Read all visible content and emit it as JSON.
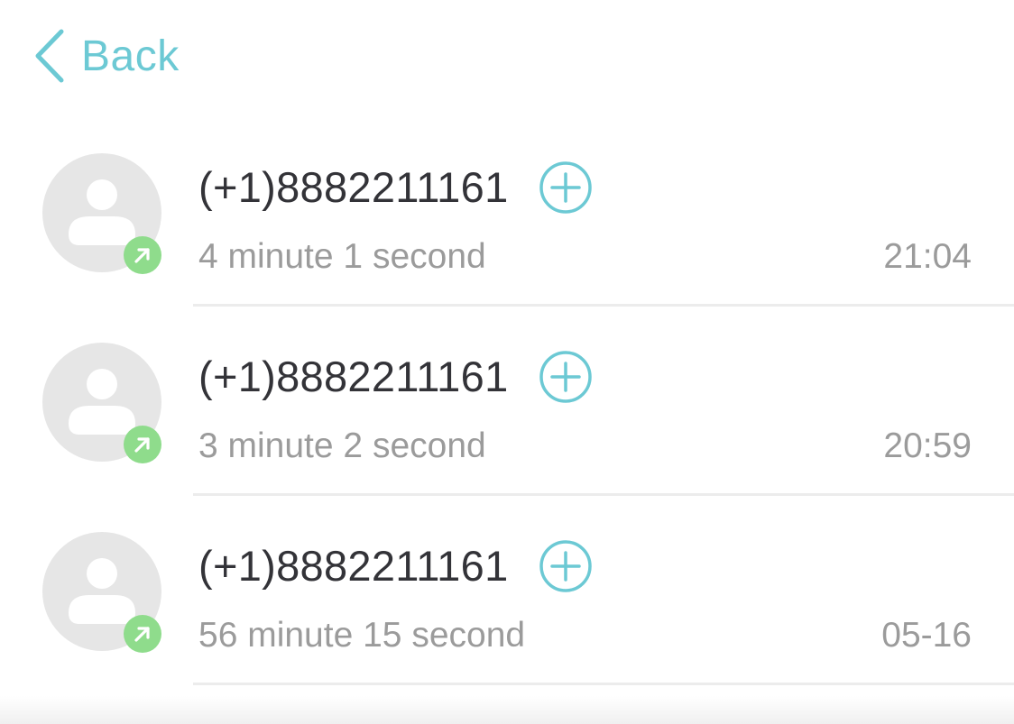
{
  "nav": {
    "back_label": "Back"
  },
  "colors": {
    "accent": "#6cc9d4",
    "outgoing_badge": "#8fdc8c",
    "primary_text": "#333338",
    "secondary_text": "#9b9b9b"
  },
  "icons": {
    "back": "chevron-left-icon",
    "avatar": "person-icon",
    "call_direction": "outgoing-call-arrow-icon",
    "add_contact": "plus-circle-icon"
  },
  "calls": [
    {
      "number": "(+1)8882211161",
      "duration": "4 minute 1 second",
      "time": "21:04"
    },
    {
      "number": "(+1)8882211161",
      "duration": "3 minute 2 second",
      "time": "20:59"
    },
    {
      "number": "(+1)8882211161",
      "duration": "56 minute 15 second",
      "time": "05-16"
    }
  ]
}
